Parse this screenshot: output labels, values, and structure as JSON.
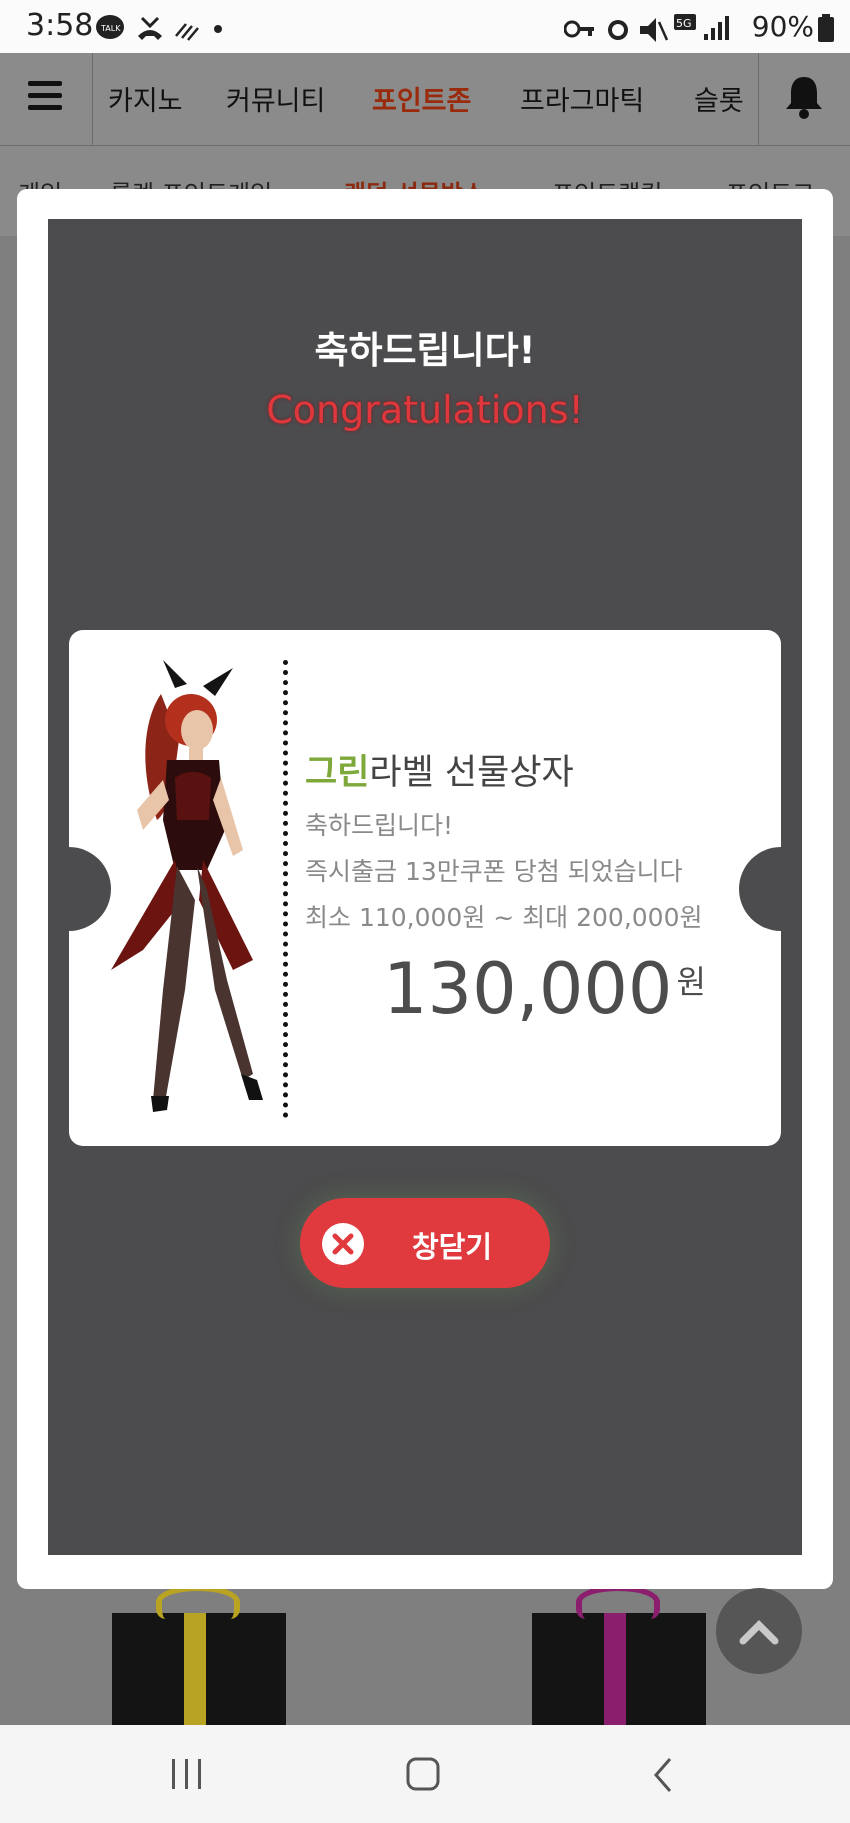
{
  "status_bar": {
    "time": "3:58",
    "battery": "90%",
    "left_icons": [
      "kakaotalk-icon",
      "missed-call-icon",
      "signal-dots-icon"
    ],
    "right_icons": [
      "vpn-key-icon",
      "alarm-icon",
      "mute-icon",
      "5g-icon",
      "signal-icon",
      "battery-icon"
    ]
  },
  "topnav": {
    "items": [
      "카지노",
      "커뮤니티",
      "포인트존",
      "프라그마틱",
      "슬롯"
    ],
    "active_index": 2,
    "accent_color": "#9a2a0c"
  },
  "subnav": {
    "items": [
      "게임",
      "룰렛 포인트게임",
      "랜덤 선물박스",
      "포인트랭킹",
      "포인트교"
    ],
    "active_index": 2
  },
  "modal": {
    "title": "축하드립니다!",
    "subtitle": "Congratulations!",
    "prize": {
      "title_highlight": "그린",
      "title_rest": "라벨 선물상자",
      "line1": "축하드립니다!",
      "line2": "즉시출금 13만쿠폰 당첨 되었습니다",
      "line3": "최소 110,000원 ~ 최대 200,000원",
      "amount": "130,000",
      "currency": "원"
    },
    "close_label": "창닫기",
    "accent_red": "#e03a3e",
    "highlight_green": "#7ea93a"
  },
  "gifts": [
    {
      "ribbon_color": "#b8a322"
    },
    {
      "ribbon_color": "#8b1f6e"
    }
  ],
  "android_nav": [
    "recents-icon",
    "home-icon",
    "back-icon"
  ]
}
